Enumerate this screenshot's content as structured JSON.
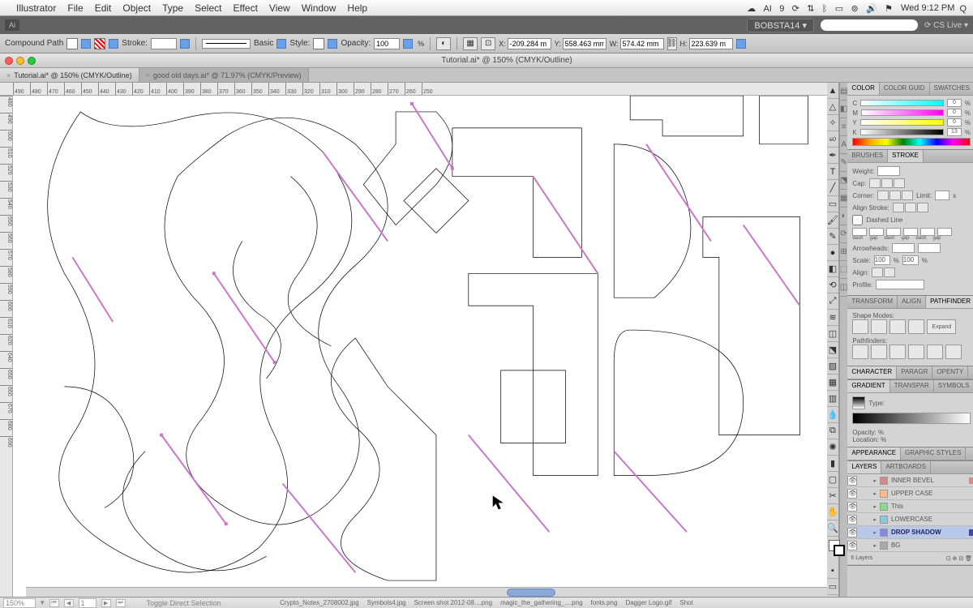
{
  "mac_menu": [
    "Illustrator",
    "File",
    "Edit",
    "Object",
    "Type",
    "Select",
    "Effect",
    "View",
    "Window",
    "Help"
  ],
  "mac_clock": "Wed 9:12 PM",
  "workspace": "BOBSTA14",
  "cslive": "CS Live",
  "control": {
    "object_type": "Compound Path",
    "stroke_label": "Stroke:",
    "stroke_weight": "",
    "brush_label": "Basic",
    "style_label": "Style:",
    "opacity_label": "Opacity:",
    "opacity_value": "100",
    "x_label": "X:",
    "x_value": "-209.284 m",
    "y_label": "Y:",
    "y_value": "558.463 mm",
    "w_label": "W:",
    "w_value": "574.42 mm",
    "h_label": "H:",
    "h_value": "223.639 m"
  },
  "doc_title": "Tutorial.ai* @ 150% (CMYK/Outline)",
  "tabs": [
    {
      "label": "Tutorial.ai* @ 150% (CMYK/Outline)",
      "active": true
    },
    {
      "label": "good old days.ai* @ 71.97% (CMYK/Preview)",
      "active": false
    }
  ],
  "ruler_h": [
    "490",
    "480",
    "470",
    "460",
    "450",
    "440",
    "430",
    "420",
    "410",
    "400",
    "390",
    "380",
    "370",
    "360",
    "350",
    "340",
    "330",
    "320",
    "310",
    "300",
    "290",
    "280",
    "270",
    "260",
    "250"
  ],
  "ruler_v": [
    "480",
    "490",
    "500",
    "510",
    "520",
    "530",
    "540",
    "550",
    "560",
    "570",
    "580",
    "590",
    "600",
    "610",
    "620",
    "640",
    "650",
    "660",
    "670",
    "680",
    "690"
  ],
  "status": {
    "zoom": "150%",
    "artboard": "1",
    "hint": "Toggle Direct Selection"
  },
  "panels": {
    "color": {
      "tabs": [
        "COLOR",
        "COLOR GUID",
        "SWATCHES"
      ],
      "channels": [
        {
          "label": "C",
          "val": "0"
        },
        {
          "label": "M",
          "val": "0"
        },
        {
          "label": "Y",
          "val": "0"
        },
        {
          "label": "K",
          "val": "13"
        }
      ]
    },
    "stroke": {
      "tabs": [
        "BRUSHES",
        "STROKE"
      ],
      "weight_label": "Weight:",
      "cap_label": "Cap:",
      "corner_label": "Corner:",
      "limit_label": "Limit:",
      "align_label": "Align Stroke:",
      "dashed_label": "Dashed Line",
      "dash_headers": [
        "dash",
        "gap",
        "dash",
        "gap",
        "dash",
        "gap"
      ],
      "arrow_label": "Arrowheads:",
      "scale_label": "Scale:",
      "scale_a": "100",
      "scale_b": "100",
      "align2_label": "Align:",
      "profile_label": "Profile:"
    },
    "transform": {
      "tabs": [
        "TRANSFORM",
        "ALIGN",
        "PATHFINDER"
      ],
      "shape_label": "Shape Modes:",
      "path_label": "Pathfinders:",
      "expand": "Expand"
    },
    "character": {
      "tabs": [
        "CHARACTER",
        "PARAGR",
        "OPENTY"
      ]
    },
    "gradient": {
      "tabs": [
        "GRADIENT",
        "TRANSPAR",
        "SYMBOLS"
      ],
      "type_label": "Type:",
      "opacity_label": "Opacity:",
      "location_label": "Location:"
    },
    "appearance": {
      "tabs": [
        "APPEARANCE",
        "GRAPHIC STYLES"
      ]
    },
    "layers": {
      "tabs": [
        "LAYERS",
        "ARTBOARDS"
      ],
      "items": [
        {
          "name": "INNER BEVEL",
          "color": "#d88"
        },
        {
          "name": "UPPER CASE",
          "color": "#fb8"
        },
        {
          "name": "This",
          "color": "#8d8"
        },
        {
          "name": "LOWERCASE",
          "color": "#8cd"
        },
        {
          "name": "DROP SHADOW",
          "color": "#88d",
          "selected": true
        },
        {
          "name": "BG",
          "color": "#aaa"
        }
      ],
      "footer": "6 Layers"
    }
  },
  "dock_items": [
    "Crypto_Notes_2708002.jpg",
    "Symbols4.jpg",
    "Screen shot 2012-08....png",
    "magic_the_gathering_....png",
    "fonts.png",
    "Dagger Logo.gif",
    "Shot"
  ]
}
